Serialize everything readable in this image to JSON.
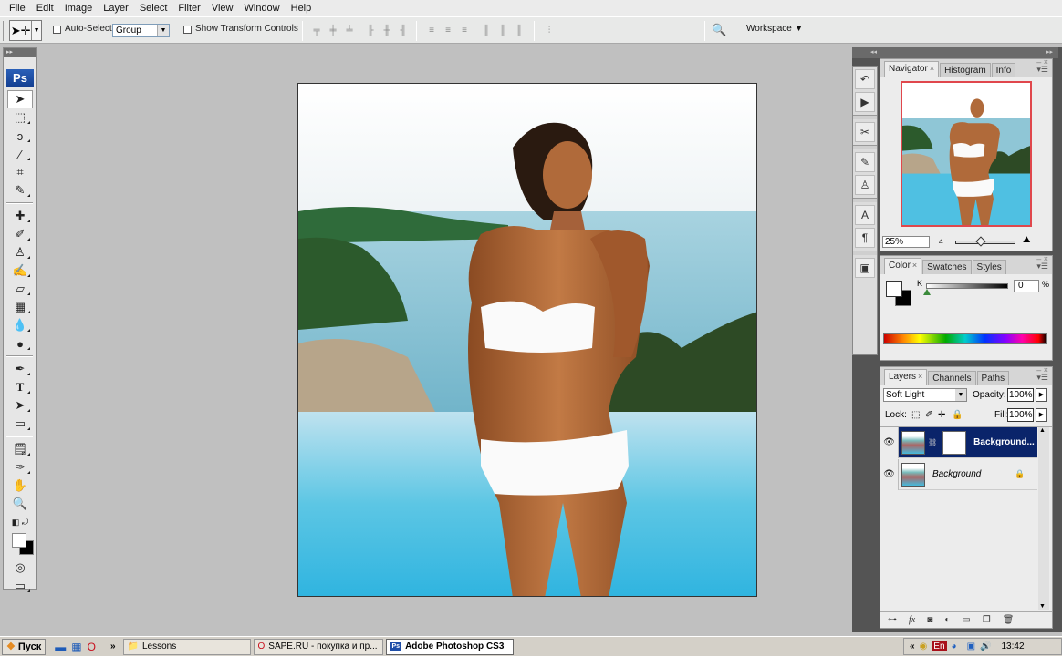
{
  "app": {
    "title": "Adobe Photoshop CS3"
  },
  "menu": [
    "File",
    "Edit",
    "Image",
    "Layer",
    "Select",
    "Filter",
    "View",
    "Window",
    "Help"
  ],
  "options": {
    "auto_select_label": "Auto-Select:",
    "auto_select_value": "Group",
    "show_transform_label": "Show Transform Controls",
    "workspace_label": "Workspace ▼"
  },
  "toolbox": {
    "logo": "Ps",
    "tools": [
      "move",
      "rectangular-marquee",
      "lasso",
      "magic-wand",
      "crop",
      "slice",
      "healing-brush",
      "brush",
      "clone-stamp",
      "history-brush",
      "eraser",
      "gradient",
      "blur",
      "dodge",
      "pen",
      "type",
      "path-selection",
      "rectangle",
      "notes",
      "eyedropper",
      "hand",
      "zoom"
    ]
  },
  "navigator": {
    "tabs": [
      "Navigator",
      "Histogram",
      "Info"
    ],
    "zoom": "25%",
    "zoom_slider_fraction": 0.35
  },
  "color": {
    "tabs": [
      "Color",
      "Swatches",
      "Styles"
    ],
    "channel_label": "K",
    "k_value": "0",
    "unit": "%",
    "foreground": "#ffffff",
    "background": "#000000"
  },
  "layers": {
    "tabs": [
      "Layers",
      "Channels",
      "Paths"
    ],
    "blend_mode": "Soft Light",
    "opacity_label": "Opacity:",
    "opacity": "100%",
    "lock_label": "Lock:",
    "fill_label": "Fill:",
    "fill": "100%",
    "items": [
      {
        "name": "Background...",
        "selected": true,
        "has_mask": true
      },
      {
        "name": "Background",
        "selected": false,
        "locked": true
      }
    ]
  },
  "taskbar": {
    "start": "Пуск",
    "windows": [
      {
        "label": "Lessons"
      },
      {
        "label": "SAPE.RU - покупка и пр..."
      },
      {
        "label": "Adobe Photoshop CS3",
        "active": true
      }
    ],
    "tray": {
      "lang": "En",
      "time": "13:42"
    },
    "chevron": "»"
  },
  "colors": {
    "selection": "#0a246a",
    "nav_frame": "#e0474c",
    "ps_blue": "#1f4ea8"
  }
}
